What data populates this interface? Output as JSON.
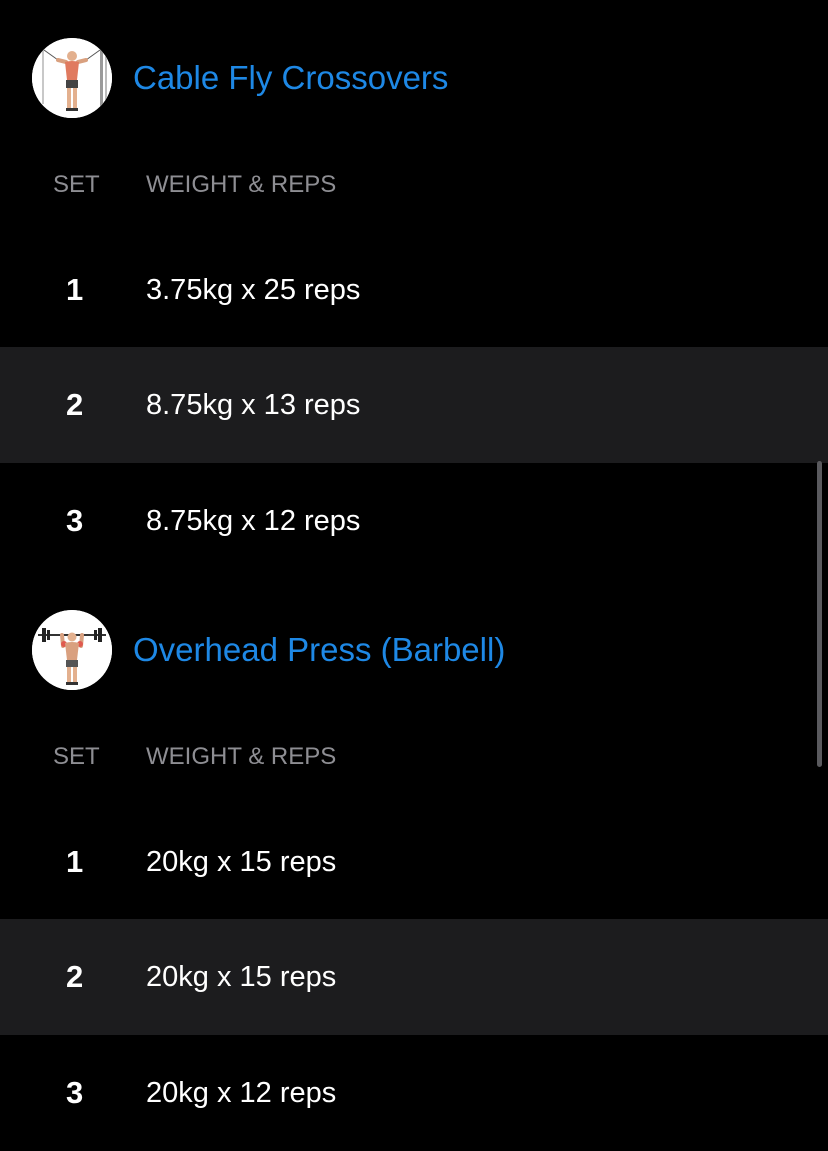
{
  "colors": {
    "background": "#000000",
    "title_accent": "#1e88e5",
    "header_text": "#8e8e93",
    "alt_row": "#1c1c1e"
  },
  "column_headers": {
    "set": "SET",
    "weight_reps": "WEIGHT & REPS"
  },
  "exercises": [
    {
      "name": "Cable Fly Crossovers",
      "thumbnail_icon": "cable-fly-figure-icon",
      "sets": [
        {
          "set": "1",
          "value": "3.75kg x 25 reps"
        },
        {
          "set": "2",
          "value": "8.75kg x 13 reps"
        },
        {
          "set": "3",
          "value": "8.75kg x 12 reps"
        }
      ]
    },
    {
      "name": "Overhead Press (Barbell)",
      "thumbnail_icon": "overhead-press-figure-icon",
      "sets": [
        {
          "set": "1",
          "value": "20kg x 15 reps"
        },
        {
          "set": "2",
          "value": "20kg x 15 reps"
        },
        {
          "set": "3",
          "value": "20kg x 12 reps"
        }
      ]
    }
  ]
}
